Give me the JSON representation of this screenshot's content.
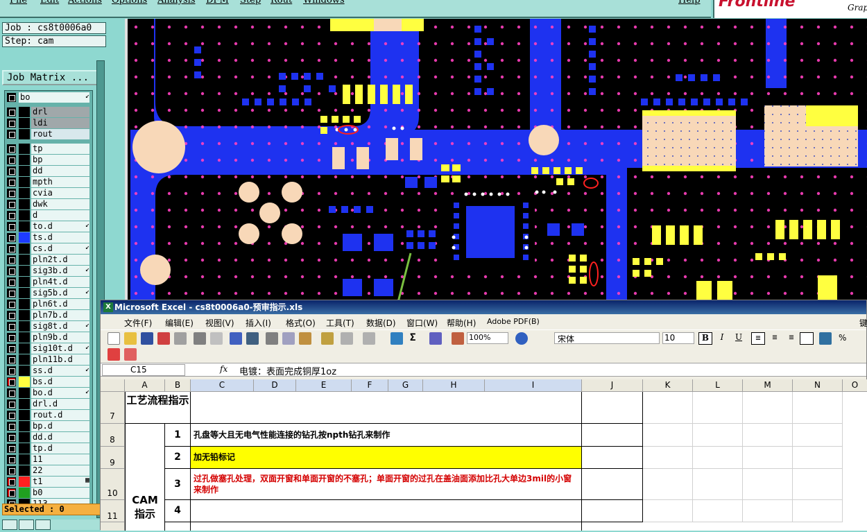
{
  "menubar": {
    "items": [
      "File",
      "Edit",
      "Actions",
      "Options",
      "Analysis",
      "DFM",
      "Step",
      "Rout",
      "Windows"
    ],
    "help": "Help"
  },
  "logo": {
    "brand": "Frontline",
    "sub": "Grap"
  },
  "job": {
    "job_label": "Job : cs8t0006a0",
    "step_label": "Step: cam",
    "matrix_button": "Job Matrix ..."
  },
  "layers": [
    {
      "name": "bo",
      "color": "#000000",
      "mark": "↙",
      "style": "top"
    },
    {
      "name": "drl",
      "color": "#000000",
      "style": "grey"
    },
    {
      "name": "ldi",
      "color": "#000000",
      "style": "grey"
    },
    {
      "name": "rout",
      "color": "#000000",
      "style": "light"
    },
    {
      "name": "tp",
      "color": "#000000"
    },
    {
      "name": "bp",
      "color": "#000000"
    },
    {
      "name": "dd",
      "color": "#000000"
    },
    {
      "name": "mpth",
      "color": "#000000"
    },
    {
      "name": "cvia",
      "color": "#000000"
    },
    {
      "name": "dwk",
      "color": "#000000"
    },
    {
      "name": "d",
      "color": "#000000"
    },
    {
      "name": "to.d",
      "color": "#000000",
      "mark": "↙"
    },
    {
      "name": "ts.d",
      "color": "#1e3cff"
    },
    {
      "name": "cs.d",
      "color": "#000000",
      "mark": "↙"
    },
    {
      "name": "pln2t.d",
      "color": "#000000"
    },
    {
      "name": "sig3b.d",
      "color": "#000000",
      "mark": "↙"
    },
    {
      "name": "pln4t.d",
      "color": "#000000"
    },
    {
      "name": "sig5b.d",
      "color": "#000000",
      "mark": "↙"
    },
    {
      "name": "pln6t.d",
      "color": "#000000"
    },
    {
      "name": "pln7b.d",
      "color": "#000000"
    },
    {
      "name": "sig8t.d",
      "color": "#000000",
      "mark": "↙"
    },
    {
      "name": "pln9b.d",
      "color": "#000000"
    },
    {
      "name": "sig10t.d",
      "color": "#000000",
      "mark": "↙"
    },
    {
      "name": "pln11b.d",
      "color": "#000000"
    },
    {
      "name": "ss.d",
      "color": "#000000",
      "mark": "↙"
    },
    {
      "name": "bs.d",
      "color": "#ffff40",
      "chk": "#cc0000"
    },
    {
      "name": "bo.d",
      "color": "#000000",
      "mark": "↙"
    },
    {
      "name": "drl.d",
      "color": "#000000"
    },
    {
      "name": "rout.d",
      "color": "#000000"
    },
    {
      "name": "bp.d",
      "color": "#000000"
    },
    {
      "name": "dd.d",
      "color": "#000000"
    },
    {
      "name": "tp.d",
      "color": "#000000"
    },
    {
      "name": "11",
      "color": "#000000"
    },
    {
      "name": "22",
      "color": "#000000"
    },
    {
      "name": "t1",
      "color": "#ff2020",
      "chk": "#cc0000",
      "mark": "▦"
    },
    {
      "name": "b0",
      "color": "#20a020",
      "chk": "#cc0000"
    },
    {
      "name": "113",
      "color": "#000000"
    }
  ],
  "selected_label": "Selected : 0",
  "excel": {
    "title": "Microsoft Excel - cs8t0006a0-预审指示.xls",
    "menu": [
      "文件(F)",
      "编辑(E)",
      "视图(V)",
      "插入(I)",
      "格式(O)",
      "工具(T)",
      "数据(D)",
      "窗口(W)",
      "帮助(H)",
      "Adobe PDF(B)"
    ],
    "menu_right": "键",
    "zoom": "100%",
    "font": "宋体",
    "font_size": "10",
    "name_box": "C15",
    "fx": "fx",
    "formula": "电镀：表面完成铜厚1oz",
    "columns": [
      "A",
      "B",
      "C",
      "D",
      "E",
      "F",
      "G",
      "H",
      "I",
      "J",
      "K",
      "L",
      "M",
      "N",
      "O"
    ],
    "rows": [
      "7",
      "8",
      "9",
      "10",
      "11"
    ],
    "cell_a7": "工艺流程指示",
    "cell_a_cam": "CAM指示",
    "items": [
      {
        "num": "1",
        "text": "孔盘等大且无电气性能连接的钻孔按npth钻孔来制作",
        "color": "#000000",
        "bg": "#ffffff"
      },
      {
        "num": "2",
        "text": "加无铅标记",
        "color": "#000000",
        "bg": "#ffff00"
      },
      {
        "num": "3",
        "text": "过孔做塞孔处理，双面开窗和单面开窗的不塞孔；单面开窗的过孔在盖油面添加比孔大单边3mil的小窗来制作",
        "color": "#d40000",
        "bg": "#ffffff"
      },
      {
        "num": "4",
        "text": "",
        "color": "#000000",
        "bg": "#ffffff"
      }
    ]
  }
}
